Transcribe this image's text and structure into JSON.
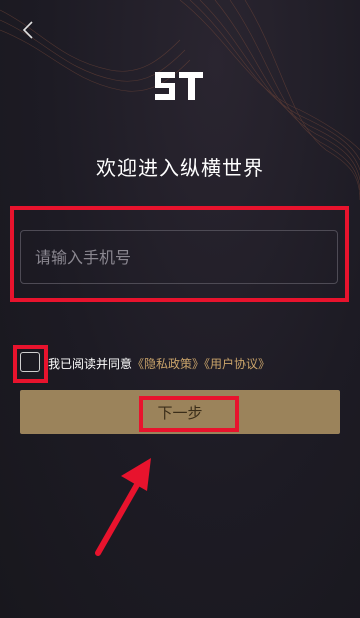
{
  "header": {
    "back_icon": "chevron-left-icon"
  },
  "logo": {
    "text": "5T"
  },
  "title": "欢迎进入纵横世界",
  "phone": {
    "placeholder": "请输入手机号",
    "value": ""
  },
  "agreement": {
    "checked": false,
    "prefix": "我已阅读并同意",
    "privacy_link": "《隐私政策》",
    "terms_link": "《用户协议》"
  },
  "next_button": {
    "label": "下一步"
  },
  "colors": {
    "background": "#1d1b24",
    "button": "#9b835b",
    "link": "#c9a36a",
    "annotation": "#e8132d"
  }
}
